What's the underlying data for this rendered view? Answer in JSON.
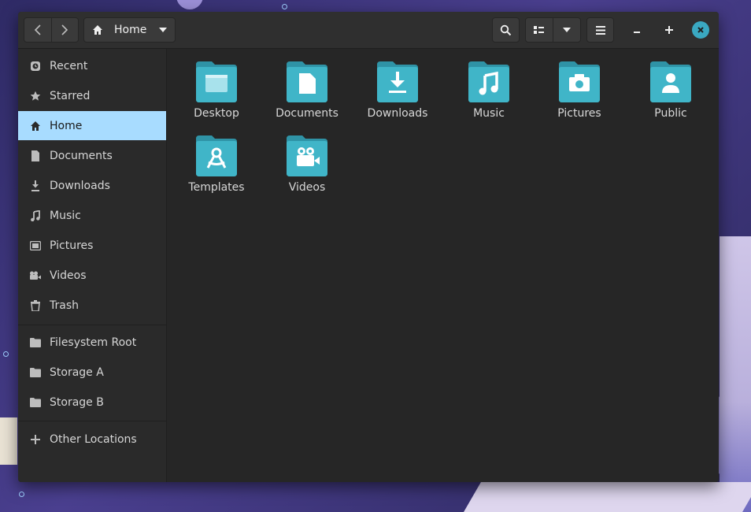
{
  "header": {
    "path_label": "Home",
    "icons": {
      "back": "chevron-left-icon",
      "forward": "chevron-right-icon",
      "home": "home-icon",
      "path_dropdown": "caret-down-icon",
      "search": "search-icon",
      "view": "list-view-icon",
      "view_dropdown": "caret-down-icon",
      "menu": "hamburger-menu-icon",
      "minimize": "minimize-icon",
      "maximize": "maximize-icon",
      "close": "close-icon"
    }
  },
  "sidebar": {
    "items": [
      {
        "label": "Recent",
        "icon": "clock-icon"
      },
      {
        "label": "Starred",
        "icon": "star-icon"
      },
      {
        "label": "Home",
        "icon": "home-icon",
        "active": true
      },
      {
        "label": "Documents",
        "icon": "document-icon"
      },
      {
        "label": "Downloads",
        "icon": "download-icon"
      },
      {
        "label": "Music",
        "icon": "music-note-icon"
      },
      {
        "label": "Pictures",
        "icon": "picture-icon"
      },
      {
        "label": "Videos",
        "icon": "video-camera-icon"
      },
      {
        "label": "Trash",
        "icon": "trash-icon"
      }
    ],
    "drives": [
      {
        "label": "Filesystem Root",
        "icon": "folder-icon"
      },
      {
        "label": "Storage A",
        "icon": "folder-icon"
      },
      {
        "label": "Storage B",
        "icon": "folder-icon"
      }
    ],
    "other": {
      "label": "Other Locations",
      "icon": "plus-icon"
    }
  },
  "files": [
    {
      "name": "Desktop",
      "icon": "desktop-folder-icon"
    },
    {
      "name": "Documents",
      "icon": "documents-folder-icon"
    },
    {
      "name": "Downloads",
      "icon": "downloads-folder-icon"
    },
    {
      "name": "Music",
      "icon": "music-folder-icon"
    },
    {
      "name": "Pictures",
      "icon": "pictures-folder-icon"
    },
    {
      "name": "Public",
      "icon": "public-folder-icon"
    },
    {
      "name": "Templates",
      "icon": "templates-folder-icon"
    },
    {
      "name": "Videos",
      "icon": "videos-folder-icon"
    }
  ],
  "colors": {
    "accent": "#3aa8c1",
    "folder": "#40b5c8",
    "folder_tab": "#2f93a6",
    "sidebar_active": "#a8dcff",
    "window_bg": "#262626"
  }
}
